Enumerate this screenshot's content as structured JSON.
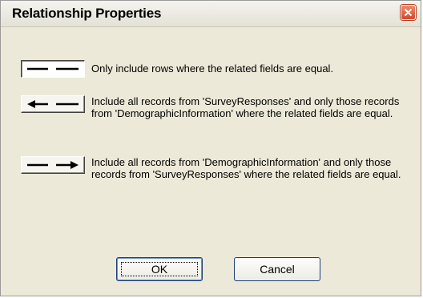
{
  "window": {
    "title": "Relationship Properties",
    "close_icon": "close-icon"
  },
  "join_options": [
    {
      "icon": "join-inner-icon",
      "text": "Only include rows where the related fields are equal.",
      "selected": true
    },
    {
      "icon": "join-left-arrow-icon",
      "text": "Include all records from 'SurveyResponses' and only those records from 'DemographicInformation' where the related fields are equal.",
      "selected": false
    },
    {
      "icon": "join-right-arrow-icon",
      "text": "Include all records from 'DemographicInformation' and only those records from 'SurveyResponses' where the related fields are equal.",
      "selected": false
    }
  ],
  "buttons": {
    "ok_label": "OK",
    "cancel_label": "Cancel"
  },
  "colors": {
    "dialog_background": "#ece9d8",
    "close_button": "#d2492a",
    "button_border": "#1c3f74"
  }
}
